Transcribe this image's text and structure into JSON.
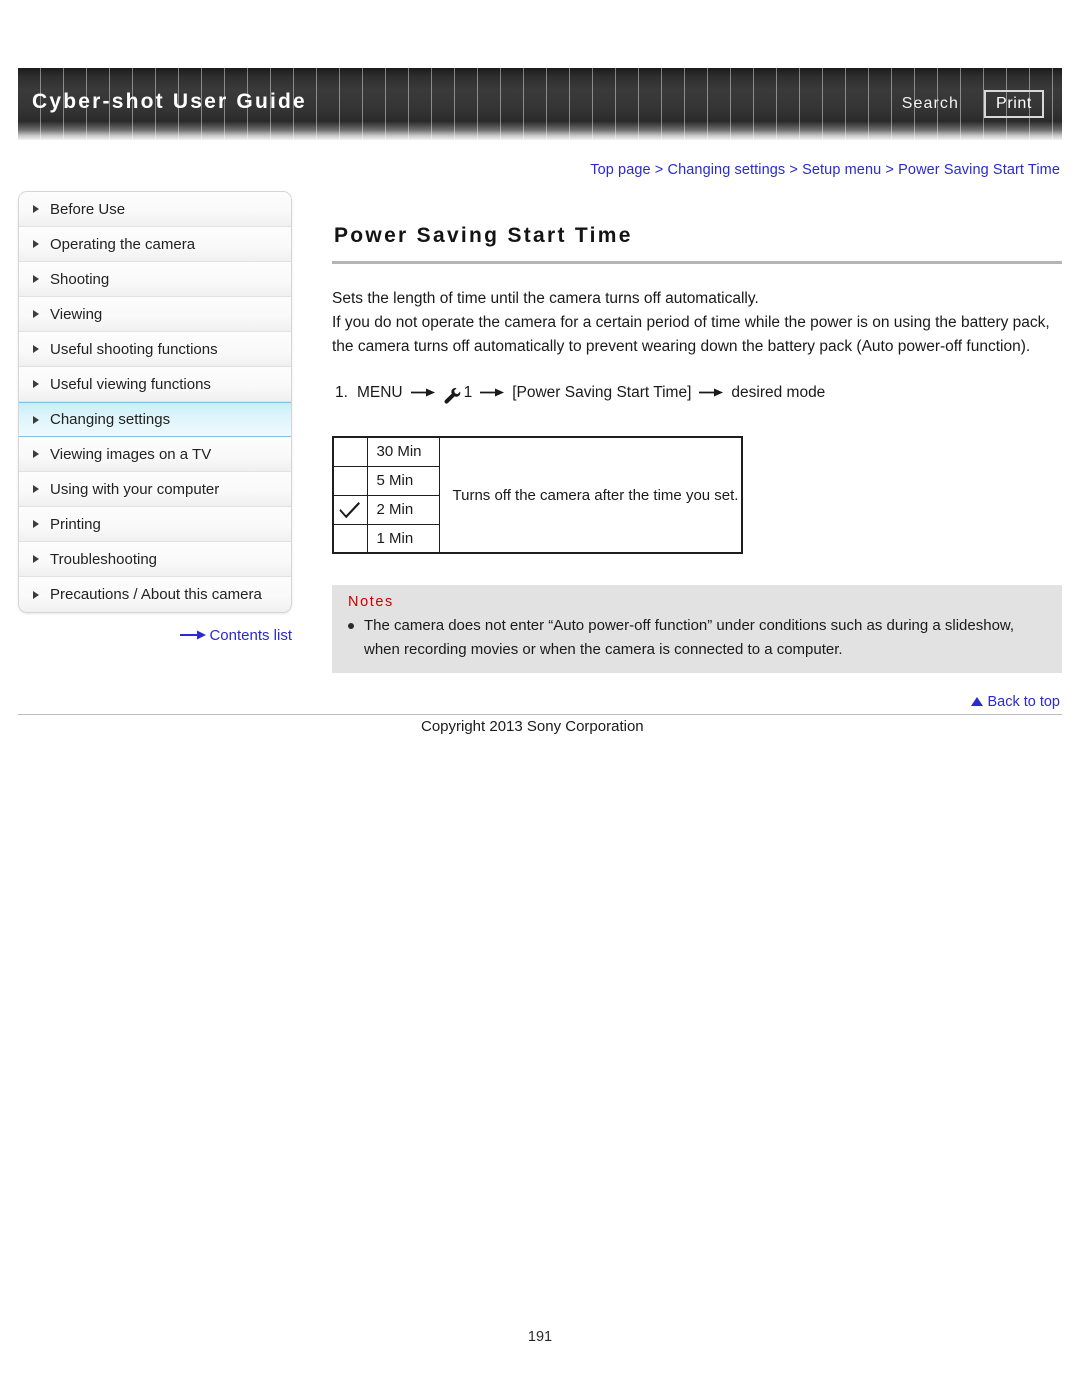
{
  "header": {
    "title": "Cyber-shot User Guide",
    "search_label": "Search",
    "print_label": "Print"
  },
  "breadcrumb": {
    "text": "Top page > Changing settings > Setup menu > Power Saving Start Time",
    "color": "#2a2ad0"
  },
  "sidebar": {
    "items": [
      {
        "label": "Before Use",
        "selected": false
      },
      {
        "label": "Operating the camera",
        "selected": false
      },
      {
        "label": "Shooting",
        "selected": false
      },
      {
        "label": "Viewing",
        "selected": false
      },
      {
        "label": "Useful shooting functions",
        "selected": false
      },
      {
        "label": "Useful viewing functions",
        "selected": false
      },
      {
        "label": "Changing settings",
        "selected": true
      },
      {
        "label": "Viewing images on a TV",
        "selected": false
      },
      {
        "label": "Using with your computer",
        "selected": false
      },
      {
        "label": "Printing",
        "selected": false
      },
      {
        "label": "Troubleshooting",
        "selected": false
      },
      {
        "label": "Precautions / About this camera",
        "selected": false
      }
    ],
    "contents_list_label": "Contents list",
    "highlight_color": "#c9eef7"
  },
  "main": {
    "title": "Power Saving Start Time",
    "paragraphs": [
      "Sets the length of time until the camera turns off automatically.",
      "If you do not operate the camera for a certain period of time while the power is on using the battery pack, the camera turns off automatically to prevent wearing down the battery pack (Auto power-off function)."
    ],
    "step": {
      "number": "1.",
      "menu_label": "MENU",
      "wrench_icon": "wrench-icon",
      "tab_number": "1",
      "item_label": "[Power Saving Start Time]",
      "result_label": "desired mode",
      "arrow": "→"
    },
    "table": {
      "description": "Turns off the camera after the time you set.",
      "rows": [
        {
          "checked": false,
          "label": "30 Min"
        },
        {
          "checked": false,
          "label": "5 Min"
        },
        {
          "checked": true,
          "label": "2 Min"
        },
        {
          "checked": false,
          "label": "1 Min"
        }
      ]
    },
    "notes": {
      "heading": "Notes",
      "items": [
        "The camera does not enter “Auto power-off function” under conditions such as during a slideshow, when recording movies or when the camera is connected to a computer."
      ],
      "heading_color": "#cc0000",
      "background": "#e2e2e2"
    }
  },
  "footer": {
    "back_to_top_label": "Back to top",
    "copyright": "Copyright 2013 Sony Corporation",
    "page_number": "191"
  }
}
